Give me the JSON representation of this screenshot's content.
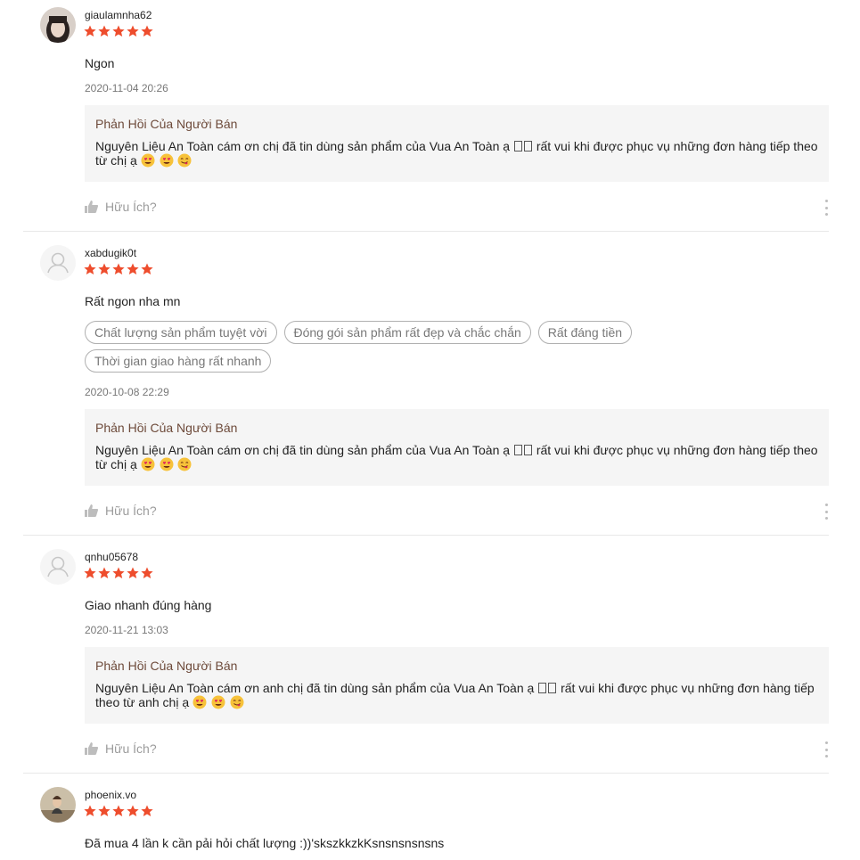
{
  "colors": {
    "star": "#ee4d2d",
    "reply_title": "#6d4a3a",
    "reply_bg": "#f5f5f5",
    "muted": "rgba(0,0,0,.54)"
  },
  "reviews": [
    {
      "username": "giaulamnha62",
      "rating": 5,
      "comment": "Ngon",
      "tags": [],
      "time": "2020-11-04 20:26",
      "reply_title": "Phản Hồi Của Người Bán",
      "reply_line1_a": "Nguyên Liệu An Toàn cám ơn chị đã tin dùng sản phẩm của Vua An Toàn ạ",
      "reply_line1_b": "rất vui khi được phục vụ những đơn hàng tiếp theo",
      "reply_line2": "từ chị ạ",
      "helpful_label": "Hữu Ích?"
    },
    {
      "username": "xabdugik0t",
      "rating": 5,
      "comment": "Rất ngon nha mn",
      "tags": [
        "Chất lượng sản phẩm tuyệt vời",
        "Đóng gói sản phẩm rất đẹp và chắc chắn",
        "Rất đáng tiền",
        "Thời gian giao hàng rất nhanh"
      ],
      "time": "2020-10-08 22:29",
      "reply_title": "Phản Hồi Của Người Bán",
      "reply_line1_a": "Nguyên Liệu An Toàn cám ơn chị đã tin dùng sản phẩm của Vua An Toàn ạ",
      "reply_line1_b": "rất vui khi được phục vụ những đơn hàng tiếp theo",
      "reply_line2": "từ chị ạ",
      "helpful_label": "Hữu Ích?"
    },
    {
      "username": "qnhu05678",
      "rating": 5,
      "comment": "Giao nhanh đúng hàng",
      "tags": [],
      "time": "2020-11-21 13:03",
      "reply_title": "Phản Hồi Của Người Bán",
      "reply_line1_a": "Nguyên Liệu An Toàn cám ơn anh chị đã tin dùng sản phẩm của Vua An Toàn ạ",
      "reply_line1_b": "rất vui khi được phục vụ những đơn hàng tiếp",
      "reply_line2": "theo từ anh chị ạ",
      "helpful_label": "Hữu Ích?"
    },
    {
      "username": "phoenix.vo",
      "rating": 5,
      "comment": "Đã mua 4 lần k cần pải hỏi chất lượng :))'skszkkzkKsnsnsnsnsns"
    }
  ]
}
